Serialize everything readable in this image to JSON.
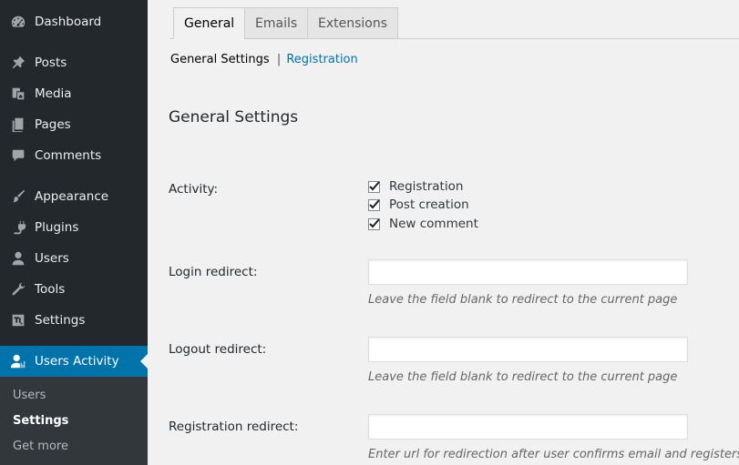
{
  "sidebar": {
    "items": [
      {
        "label": "Dashboard",
        "icon": "dashboard-icon"
      },
      {
        "label": "Posts",
        "icon": "pin-icon"
      },
      {
        "label": "Media",
        "icon": "media-icon"
      },
      {
        "label": "Pages",
        "icon": "pages-icon"
      },
      {
        "label": "Comments",
        "icon": "comment-icon"
      },
      {
        "label": "Appearance",
        "icon": "brush-icon"
      },
      {
        "label": "Plugins",
        "icon": "plug-icon"
      },
      {
        "label": "Users",
        "icon": "user-icon"
      },
      {
        "label": "Tools",
        "icon": "wrench-icon"
      },
      {
        "label": "Settings",
        "icon": "sliders-icon"
      },
      {
        "label": "Users Activity",
        "icon": "users-activity-icon"
      }
    ],
    "submenu": [
      "Users",
      "Settings",
      "Get more"
    ],
    "active_color": "#0073aa"
  },
  "tabs": [
    "General",
    "Emails",
    "Extensions"
  ],
  "subnav": {
    "current": "General Settings",
    "separator": "|",
    "link": "Registration"
  },
  "page_title": "General Settings",
  "form": {
    "activity_label": "Activity:",
    "activity_options": [
      {
        "label": "Registration",
        "checked": true
      },
      {
        "label": "Post creation",
        "checked": true
      },
      {
        "label": "New comment",
        "checked": true
      }
    ],
    "login_label": "Login redirect:",
    "login_value": "",
    "login_hint": "Leave the field blank to redirect to the current page",
    "logout_label": "Logout redirect:",
    "logout_value": "",
    "logout_hint": "Leave the field blank to redirect to the current page",
    "registration_label": "Registration redirect:",
    "registration_value": "",
    "registration_hint": "Enter url for redirection after user confirms email and registers"
  }
}
